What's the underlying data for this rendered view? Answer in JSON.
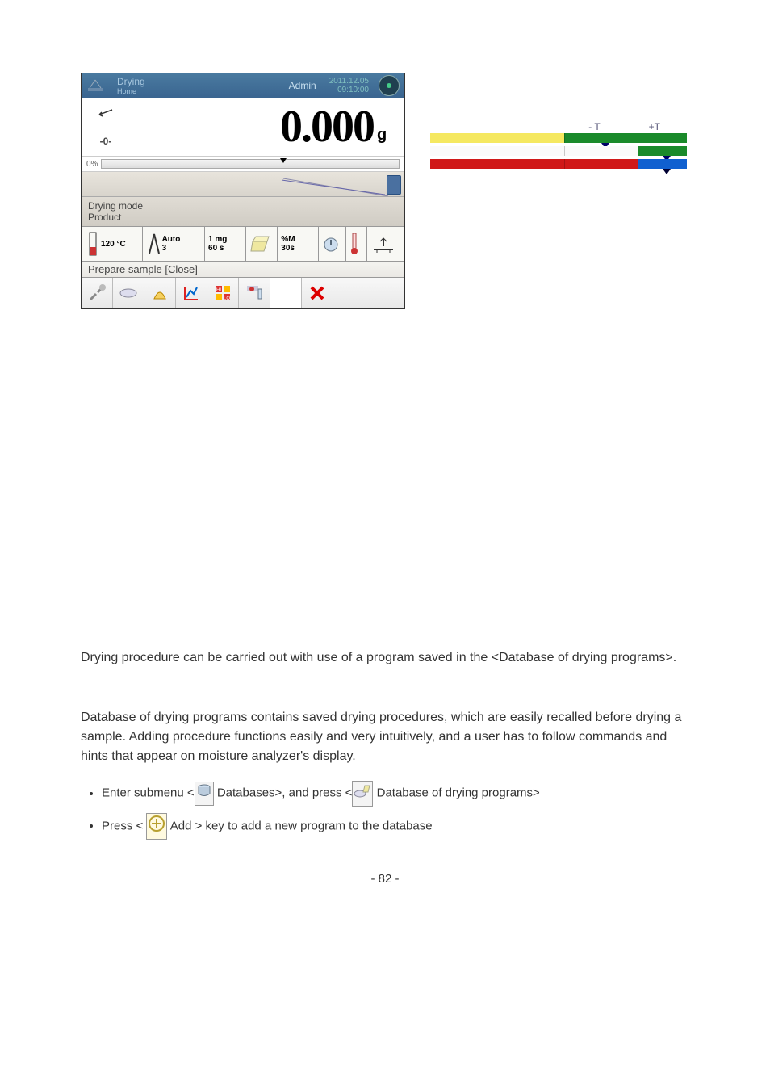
{
  "device": {
    "titlebar": {
      "mode": "Drying",
      "sub": "Home",
      "user": "Admin",
      "date": "2011.12.05",
      "time": "09:10:00"
    },
    "readout": {
      "level_icon": "level-icon",
      "zero_marker": "-0-",
      "value": "0.000",
      "unit": "g",
      "progress_pct": "0%"
    },
    "labels": {
      "line1": "Drying mode",
      "line2": "Product"
    },
    "params": {
      "temp": "120 °C",
      "auto_label": "Auto",
      "auto_sub": "3",
      "mg": "1 mg",
      "finish_time": "60 s",
      "pctM": "%M",
      "interval": "30s"
    },
    "prepare": "Prepare sample [Close]"
  },
  "tare": {
    "minus": "- T",
    "plus": "+T"
  },
  "text": {
    "para1": "Drying procedure can be carried out with use of a program saved in the <Database of drying programs>.",
    "para2": "Database of drying programs contains saved drying procedures, which are easily recalled before drying a sample. Adding procedure functions easily and very intuitively, and a user has to follow commands and hints that appear on moisture analyzer's display.",
    "bullet1_a": "Enter submenu <",
    "bullet1_b": " Databases>, and press <",
    "bullet1_c": " Database of drying programs>",
    "bullet2_a": "Press < ",
    "bullet2_b": " Add > key to add a new program to the database"
  },
  "footer": "- 82 -"
}
